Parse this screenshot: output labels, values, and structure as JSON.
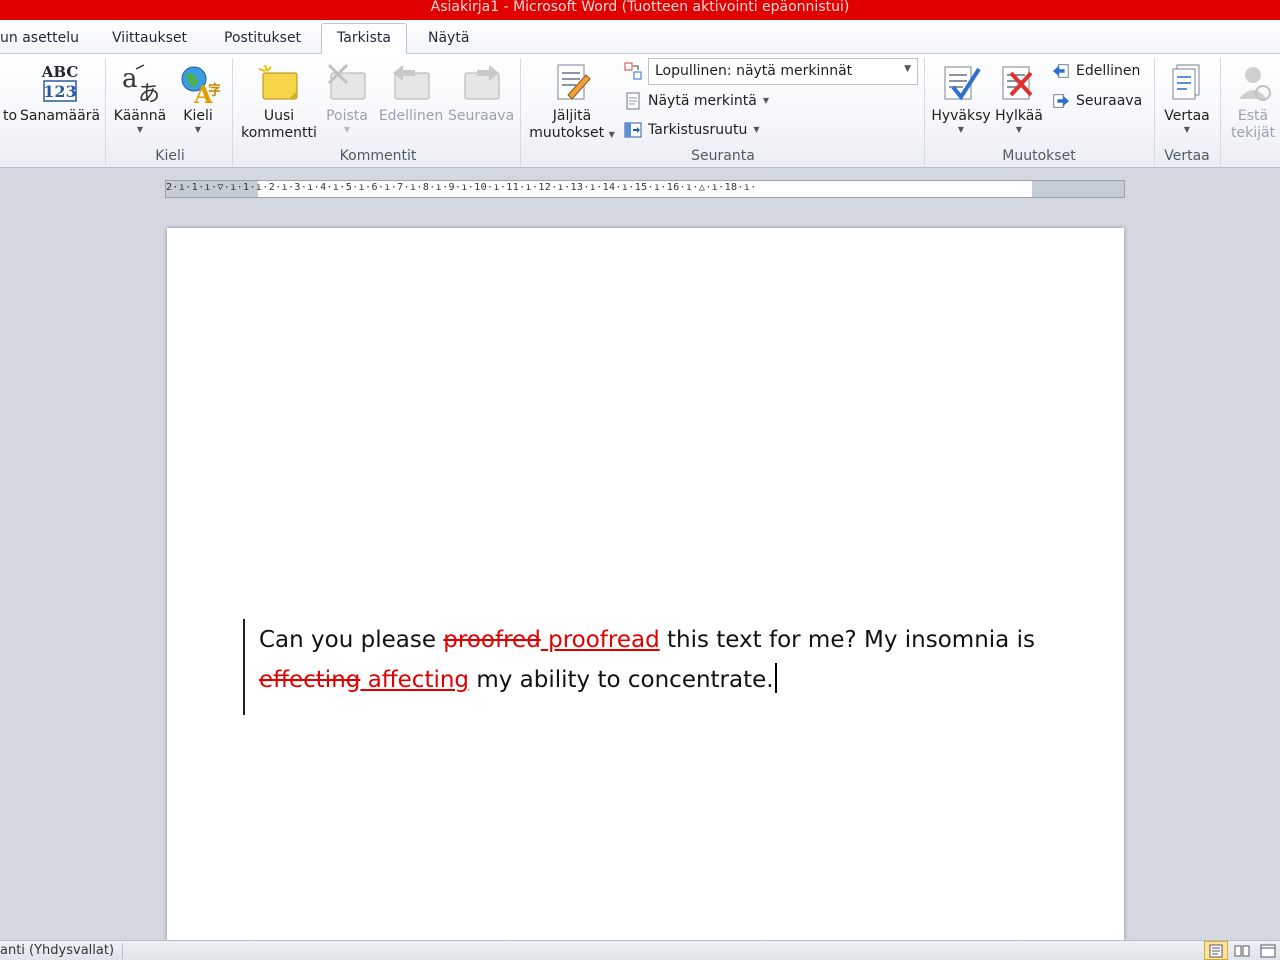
{
  "window": {
    "title": "Asiakirja1  -  Microsoft Word (Tuotteen aktivointi epäonnistui)"
  },
  "tabs": [
    {
      "label": "un asettelu",
      "active": false
    },
    {
      "label": "Viittaukset",
      "active": false
    },
    {
      "label": "Postitukset",
      "active": false
    },
    {
      "label": "Tarkista",
      "active": true
    },
    {
      "label": "Näytä",
      "active": false
    }
  ],
  "ribbon": {
    "proofing": {
      "cut_label": "to",
      "wordcount_label": "Sanamäärä"
    },
    "language": {
      "group_label": "Kieli",
      "translate_label": "Käännä",
      "language_label": "Kieli"
    },
    "comments": {
      "group_label": "Kommentit",
      "new_comment_line1": "Uusi",
      "new_comment_line2": "kommentti",
      "delete_label": "Poista",
      "previous_label": "Edellinen",
      "next_label": "Seuraava"
    },
    "tracking": {
      "group_label": "Seuranta",
      "track_changes_line1": "Jäljitä",
      "track_changes_line2": "muutokset",
      "display_mode": "Lopullinen: näytä merkinnät",
      "show_markup_label": "Näytä merkintä",
      "reviewing_pane_label": "Tarkistusruutu"
    },
    "changes": {
      "group_label": "Muutokset",
      "accept_label": "Hyväksy",
      "reject_label": "Hylkää",
      "previous_label": "Edellinen",
      "next_label": "Seuraava"
    },
    "compare": {
      "group_label": "Vertaa",
      "compare_label": "Vertaa"
    },
    "protect": {
      "block_authors_line1": "Estä",
      "block_authors_line2": "tekijät"
    }
  },
  "ruler": {
    "ticks": "2·ı·1·ı·▽·ı·1·ı·2·ı·3·ı·4·ı·5·ı·6·ı·7·ı·8·ı·9·ı·10·ı·11·ı·12·ı·13·ı·14·ı·15·ı·16·ı·△·ı·18·ı·"
  },
  "document": {
    "seg1": "Can you please ",
    "del1": "proofred",
    "ins1": " proofread",
    "seg2": " this text for me? My insomnia is ",
    "del2": "effecting",
    "ins2": " affecting",
    "seg3": " my ability to concentrate."
  },
  "statusbar": {
    "language": "anti (Yhdysvallat)"
  },
  "colors": {
    "titlebar": "#e00000",
    "revision": "#e00000"
  }
}
